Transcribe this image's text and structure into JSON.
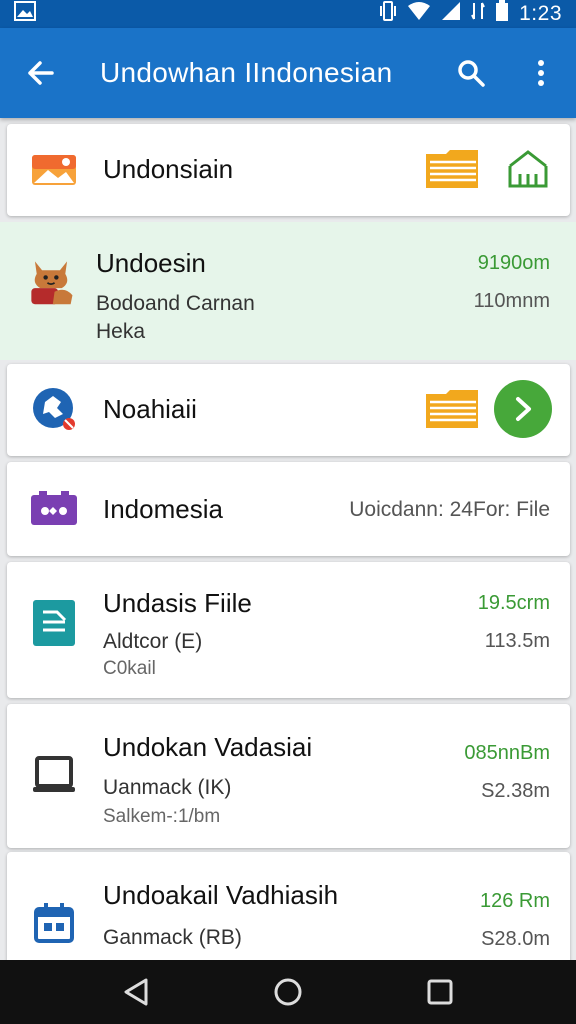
{
  "status_bar": {
    "time": "1:23"
  },
  "app_bar": {
    "title": "Undowhan IIndonesian"
  },
  "items": [
    {
      "title": "Undonsiain"
    },
    {
      "title": "Undoesin",
      "subtitle": "Bodoand Carnan",
      "subtitle2": "Heka",
      "meta_top": "9190om",
      "meta_bottom": "110mnm"
    },
    {
      "title": "Noahiaii"
    },
    {
      "title": "Indomesia",
      "meta": "Uoicdann: 24For: File"
    },
    {
      "title": "Undasis Fiile",
      "subtitle": "Aldtcor (E)",
      "subtitle2": "C0kail",
      "meta_top": "19.5crm",
      "meta_bottom": "113.5m"
    },
    {
      "title": "Undokan Vadasiai",
      "subtitle": "Uanmack (IK)",
      "subtitle2": "Salkem-:1/bm",
      "meta_top": "085nnBm",
      "meta_bottom": "S2.38m"
    },
    {
      "title": "Undoakail Vadhiasih",
      "subtitle": "Ganmack (RB)",
      "meta_top": "126 Rm",
      "meta_bottom": "S28.0m"
    }
  ],
  "colors": {
    "status_bar": "#0b5aa8",
    "app_bar": "#1a73c8",
    "accent_green": "#3a9a35",
    "accent_orange": "#f2a81d",
    "highlight_bg": "#e6f5ea"
  }
}
